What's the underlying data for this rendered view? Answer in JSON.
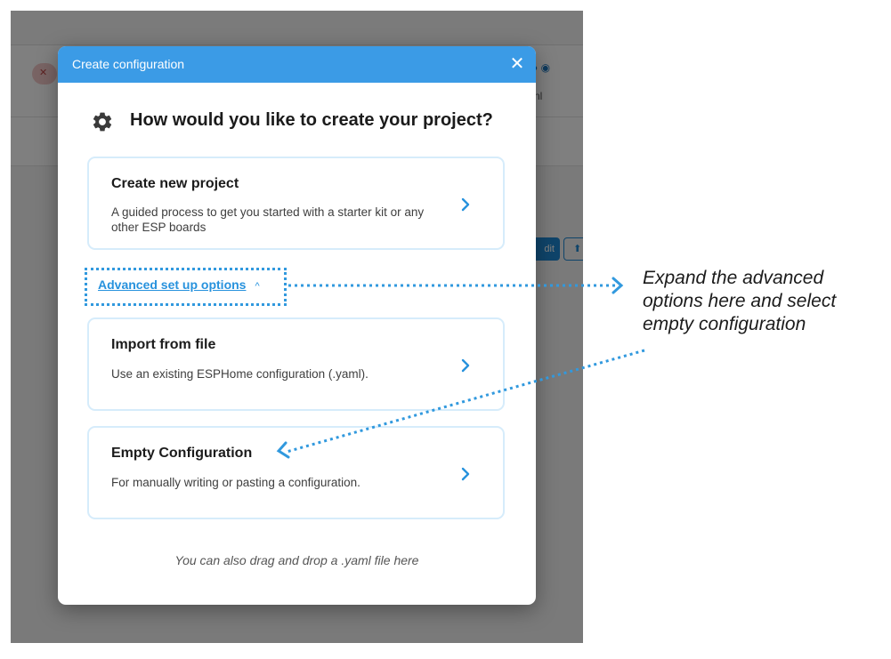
{
  "background": {
    "row_icons": "● ◉",
    "row_text": "nl",
    "edit_label": "dit",
    "upload_icon": "upload-icon"
  },
  "dialog": {
    "title": "Create configuration",
    "close_icon": "close-icon",
    "heading_icon": "gear-icon",
    "heading": "How would you like to create your project?",
    "create_new": {
      "title": "Create new project",
      "description": "A guided process to get you started with a starter kit or any other ESP boards"
    },
    "advanced_link": "Advanced set up options",
    "advanced_caret": "^",
    "import": {
      "title": "Import from file",
      "description": "Use an existing ESPHome configuration (.yaml)."
    },
    "empty": {
      "title": "Empty Configuration",
      "description": "For manually writing or pasting a configuration."
    },
    "drop_hint": "You can also drag and drop a .yaml file here"
  },
  "annotation": {
    "text": "Expand the advanced options here and select empty configuration",
    "color": "#3199de"
  },
  "colors": {
    "header": "#3b9be6",
    "link": "#2792dd",
    "chevron": "#2792dd",
    "card_border": "#d6ecfb"
  }
}
